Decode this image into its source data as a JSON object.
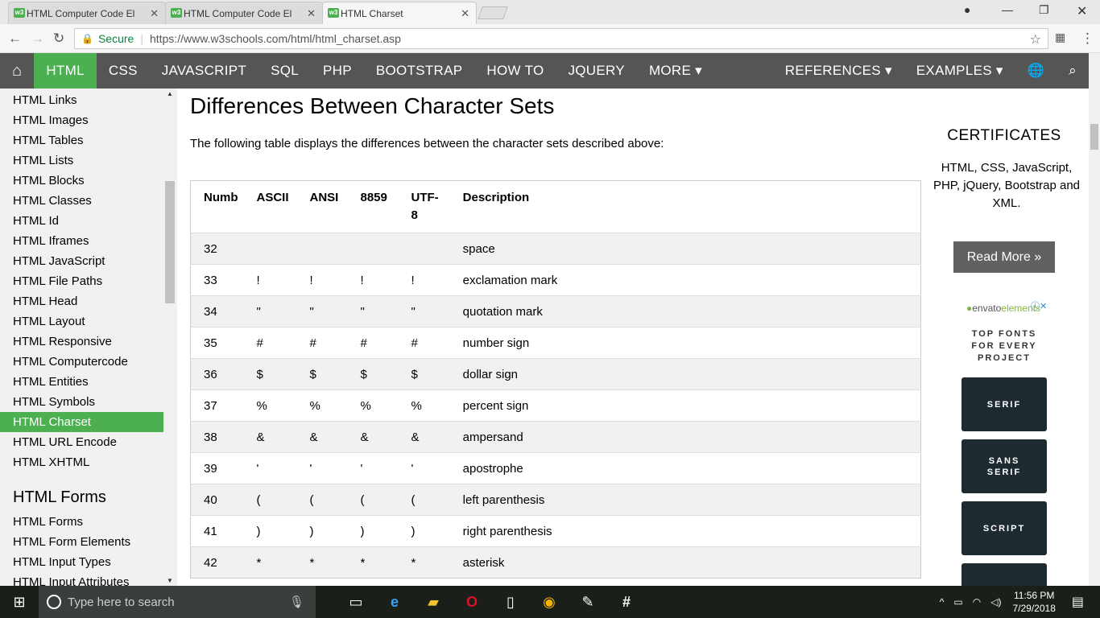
{
  "browser": {
    "tabs": [
      {
        "title": "HTML Computer Code El",
        "favicon": "w3",
        "active": false
      },
      {
        "title": "HTML Computer Code El",
        "favicon": "w3",
        "active": false
      },
      {
        "title": "HTML Charset",
        "favicon": "w3",
        "active": true
      }
    ],
    "secure_label": "Secure",
    "url": "https://www.w3schools.com/html/html_charset.asp"
  },
  "topnav": {
    "items": [
      "HTML",
      "CSS",
      "JAVASCRIPT",
      "SQL",
      "PHP",
      "BOOTSTRAP",
      "HOW TO",
      "JQUERY",
      "MORE ▾"
    ],
    "right": [
      "REFERENCES ▾",
      "EXAMPLES ▾"
    ]
  },
  "sidebar": {
    "items": [
      "HTML Links",
      "HTML Images",
      "HTML Tables",
      "HTML Lists",
      "HTML Blocks",
      "HTML Classes",
      "HTML Id",
      "HTML Iframes",
      "HTML JavaScript",
      "HTML File Paths",
      "HTML Head",
      "HTML Layout",
      "HTML Responsive",
      "HTML Computercode",
      "HTML Entities",
      "HTML Symbols",
      "HTML Charset",
      "HTML URL Encode",
      "HTML XHTML"
    ],
    "active_index": 16,
    "forms_heading": "HTML Forms",
    "forms_items": [
      "HTML Forms",
      "HTML Form Elements",
      "HTML Input Types",
      "HTML Input Attributes"
    ]
  },
  "main": {
    "heading": "Differences Between Character Sets",
    "intro": "The following table displays the differences between the character sets described above:",
    "table": {
      "headers": [
        "Numb",
        "ASCII",
        "ANSI",
        "8859",
        "UTF-8",
        "Description"
      ],
      "rows": [
        [
          "32",
          "",
          "",
          "",
          "",
          "space"
        ],
        [
          "33",
          "!",
          "!",
          "!",
          "!",
          "exclamation mark"
        ],
        [
          "34",
          "\"",
          "\"",
          "\"",
          "\"",
          "quotation mark"
        ],
        [
          "35",
          "#",
          "#",
          "#",
          "#",
          "number sign"
        ],
        [
          "36",
          "$",
          "$",
          "$",
          "$",
          "dollar sign"
        ],
        [
          "37",
          "%",
          "%",
          "%",
          "%",
          "percent sign"
        ],
        [
          "38",
          "&",
          "&",
          "&",
          "&",
          "ampersand"
        ],
        [
          "39",
          "'",
          "'",
          "'",
          "'",
          "apostrophe"
        ],
        [
          "40",
          "(",
          "(",
          "(",
          "(",
          "left parenthesis"
        ],
        [
          "41",
          ")",
          ")",
          ")",
          ")",
          "right parenthesis"
        ],
        [
          "42",
          "*",
          "*",
          "*",
          "*",
          "asterisk"
        ]
      ]
    }
  },
  "right": {
    "cert_title": "CERTIFICATES",
    "cert_text": "HTML, CSS, JavaScript, PHP, jQuery, Bootstrap and XML.",
    "read_more": "Read More »",
    "ad_logo_prefix": "envato",
    "ad_logo_suffix": "elements",
    "ad_heading": "TOP FONTS FOR EVERY PROJECT",
    "ad_cards": [
      "SERIF",
      "SANS SERIF",
      "SCRIPT"
    ]
  },
  "taskbar": {
    "search_placeholder": "Type here to search",
    "time": "11:56 PM",
    "date": "7/29/2018"
  }
}
